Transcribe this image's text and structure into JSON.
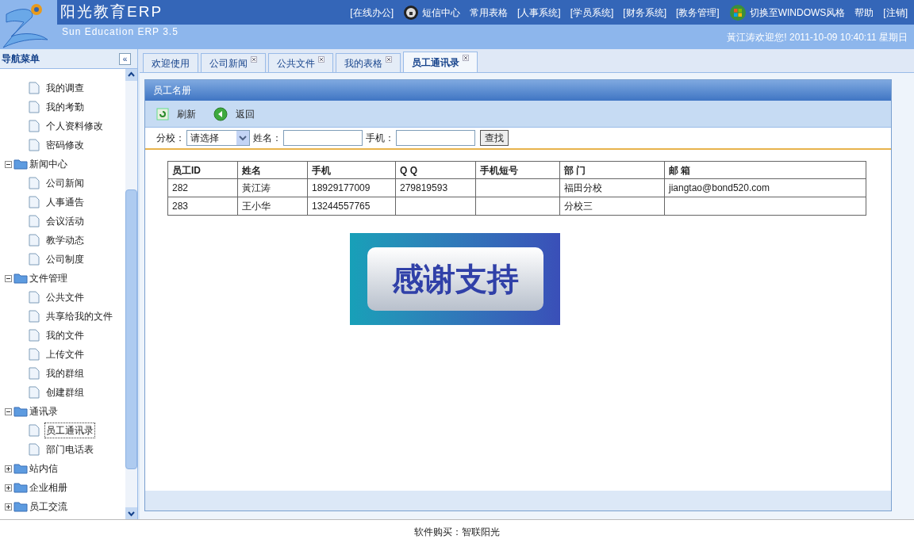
{
  "header": {
    "title": "阳光教育ERP",
    "subtitle": "Sun Education ERP 3.5",
    "nav": [
      {
        "label": "[在线办公]",
        "kind": "link"
      },
      {
        "label": "短信中心",
        "kind": "message"
      },
      {
        "label": "常用表格",
        "kind": "link"
      },
      {
        "label": "[人事系统]",
        "kind": "link"
      },
      {
        "label": "[学员系统]",
        "kind": "link"
      },
      {
        "label": "[财务系统]",
        "kind": "link"
      },
      {
        "label": "[教务管理]",
        "kind": "link"
      },
      {
        "label": "切换至WINDOWS风格",
        "kind": "windows"
      },
      {
        "label": "帮助",
        "kind": "link"
      },
      {
        "label": "[注销]",
        "kind": "link"
      }
    ],
    "welcome": "黃江涛欢迎您! 2011-10-09 10:40:11 星期日"
  },
  "sidebar": {
    "title": "导航菜单",
    "collapse": "«",
    "tree": [
      {
        "children": [
          {
            "label": "我的调查",
            "selected": false
          },
          {
            "label": "我的考勤",
            "selected": false
          },
          {
            "label": "个人资料修改",
            "selected": false
          },
          {
            "label": "密码修改",
            "selected": false
          }
        ]
      },
      {
        "label": "新闻中心",
        "expanded": true,
        "children": [
          {
            "label": "公司新闻",
            "selected": false
          },
          {
            "label": "人事通告",
            "selected": false
          },
          {
            "label": "会议活动",
            "selected": false
          },
          {
            "label": "教学动态",
            "selected": false
          },
          {
            "label": "公司制度",
            "selected": false
          }
        ]
      },
      {
        "label": "文件管理",
        "expanded": true,
        "children": [
          {
            "label": "公共文件",
            "selected": false
          },
          {
            "label": "共享给我的文件",
            "selected": false
          },
          {
            "label": "我的文件",
            "selected": false
          },
          {
            "label": "上传文件",
            "selected": false
          },
          {
            "label": "我的群组",
            "selected": false
          },
          {
            "label": "创建群组",
            "selected": false
          }
        ]
      },
      {
        "label": "通讯录",
        "expanded": true,
        "children": [
          {
            "label": "员工通讯录",
            "selected": true
          },
          {
            "label": "部门电话表",
            "selected": false
          }
        ]
      },
      {
        "label": "站内信",
        "expanded": false
      },
      {
        "label": "企业相册",
        "expanded": false
      },
      {
        "label": "员工交流",
        "expanded": false
      }
    ]
  },
  "tabs": [
    {
      "label": "欢迎使用",
      "selected": false,
      "closable": false
    },
    {
      "label": "公司新闻",
      "selected": false,
      "closable": true
    },
    {
      "label": "公共文件",
      "selected": false,
      "closable": true
    },
    {
      "label": "我的表格",
      "selected": false,
      "closable": true
    },
    {
      "label": "员工通讯录",
      "selected": true,
      "closable": true
    }
  ],
  "panel": {
    "title": "员工名册",
    "toolbar": [
      {
        "label": "刷新",
        "kind": "refresh"
      },
      {
        "label": "返回",
        "kind": "back"
      }
    ],
    "search": {
      "branch_label": "分校：",
      "branch_value": "请选择",
      "name_label": "姓名：",
      "phone_label": "手机：",
      "button": "查找"
    },
    "table": {
      "columns": [
        "员工ID",
        "姓名",
        "手机",
        "Q Q",
        "手机短号",
        "部 门",
        "邮 箱"
      ],
      "rows": [
        [
          "282",
          "黃江涛",
          "18929177009",
          "279819593",
          "",
          "福田分校",
          "jiangtao@bond520.com"
        ],
        [
          "283",
          "王小华",
          "13244557765",
          "",
          "",
          "分校三",
          ""
        ]
      ]
    },
    "banner": "感谢支持"
  },
  "footer": "软件购买：智联阳光"
}
